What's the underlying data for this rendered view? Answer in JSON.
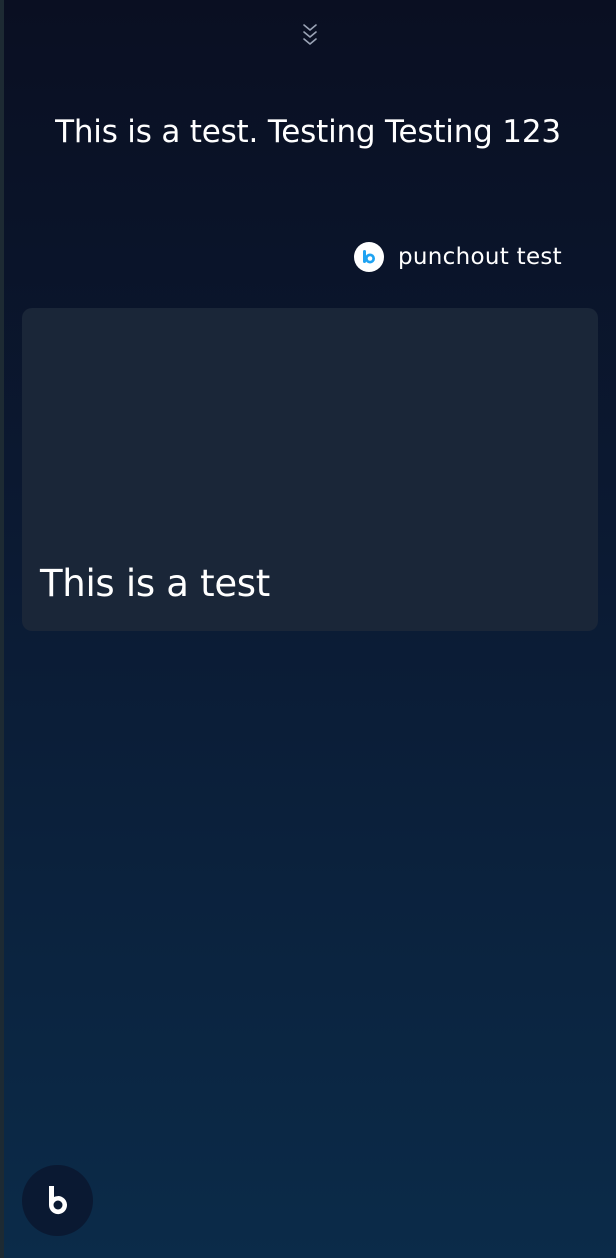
{
  "header": {
    "collapse_icon": "chevron-double-down-icon"
  },
  "conversation": {
    "utterance": "This is a test. Testing Testing 123",
    "capsule": {
      "icon": "bixby-logo-icon",
      "name": "punchout test"
    },
    "result_card": {
      "text": "This is a test"
    }
  },
  "footer": {
    "assistant_button_icon": "bixby-logo-icon"
  },
  "colors": {
    "background_top": "#0a0f22",
    "background_bottom": "#0b2b49",
    "card": "#1a2638",
    "accent_blue": "#1fa3f2"
  }
}
